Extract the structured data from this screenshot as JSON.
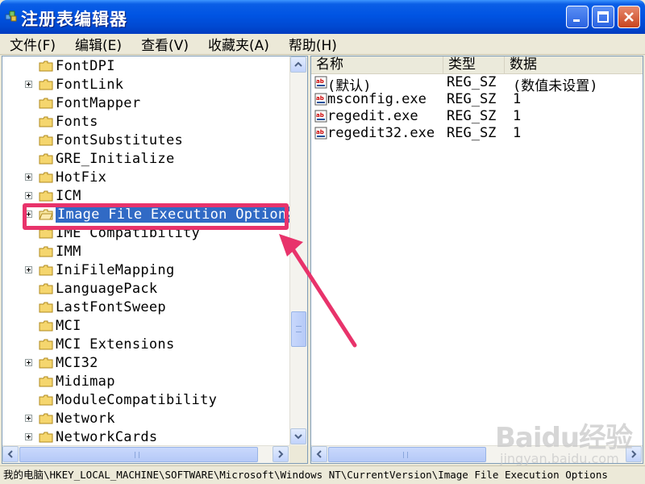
{
  "window": {
    "title": "注册表编辑器",
    "buttons": [
      "minimize",
      "maximize",
      "close"
    ]
  },
  "menu": {
    "items": [
      {
        "label": "文件(F)"
      },
      {
        "label": "编辑(E)"
      },
      {
        "label": "查看(V)"
      },
      {
        "label": "收藏夹(A)"
      },
      {
        "label": "帮助(H)"
      }
    ]
  },
  "tree": {
    "items": [
      {
        "label": "FontDPI",
        "expandable": false
      },
      {
        "label": "FontLink",
        "expandable": true
      },
      {
        "label": "FontMapper",
        "expandable": false
      },
      {
        "label": "Fonts",
        "expandable": false
      },
      {
        "label": "FontSubstitutes",
        "expandable": false
      },
      {
        "label": "GRE_Initialize",
        "expandable": false
      },
      {
        "label": "HotFix",
        "expandable": true
      },
      {
        "label": "ICM",
        "expandable": true
      },
      {
        "label": "Image File Execution Options",
        "expandable": true,
        "selected": true
      },
      {
        "label": "IME Compatibility",
        "expandable": false
      },
      {
        "label": "IMM",
        "expandable": false
      },
      {
        "label": "IniFileMapping",
        "expandable": true
      },
      {
        "label": "LanguagePack",
        "expandable": false
      },
      {
        "label": "LastFontSweep",
        "expandable": false
      },
      {
        "label": "MCI",
        "expandable": false
      },
      {
        "label": "MCI Extensions",
        "expandable": false
      },
      {
        "label": "MCI32",
        "expandable": true
      },
      {
        "label": "Midimap",
        "expandable": false
      },
      {
        "label": "ModuleCompatibility",
        "expandable": false
      },
      {
        "label": "Network",
        "expandable": true
      },
      {
        "label": "NetworkCards",
        "expandable": true
      }
    ]
  },
  "list": {
    "columns": [
      {
        "label": "名称"
      },
      {
        "label": "类型"
      },
      {
        "label": "数据"
      }
    ],
    "rows": [
      {
        "name": "(默认)",
        "type": "REG_SZ",
        "data": "(数值未设置)"
      },
      {
        "name": "msconfig.exe",
        "type": "REG_SZ",
        "data": "1"
      },
      {
        "name": "regedit.exe",
        "type": "REG_SZ",
        "data": "1"
      },
      {
        "name": "regedit32.exe",
        "type": "REG_SZ",
        "data": "1"
      }
    ]
  },
  "status": {
    "path": "我的电脑\\HKEY_LOCAL_MACHINE\\SOFTWARE\\Microsoft\\Windows NT\\CurrentVersion\\Image File Execution Options"
  },
  "watermark": {
    "brand": "Baidu经验",
    "site": "jingyan.baidu.com"
  },
  "colors": {
    "titlebar": "#0054e3",
    "selection": "#316ac5",
    "highlight_box": "#e8336b",
    "annotation_arrow": "#e8336b"
  },
  "icons": {
    "title": "registry-editor-icon",
    "tree_node": "folder-icon",
    "value": "string-value-icon"
  }
}
